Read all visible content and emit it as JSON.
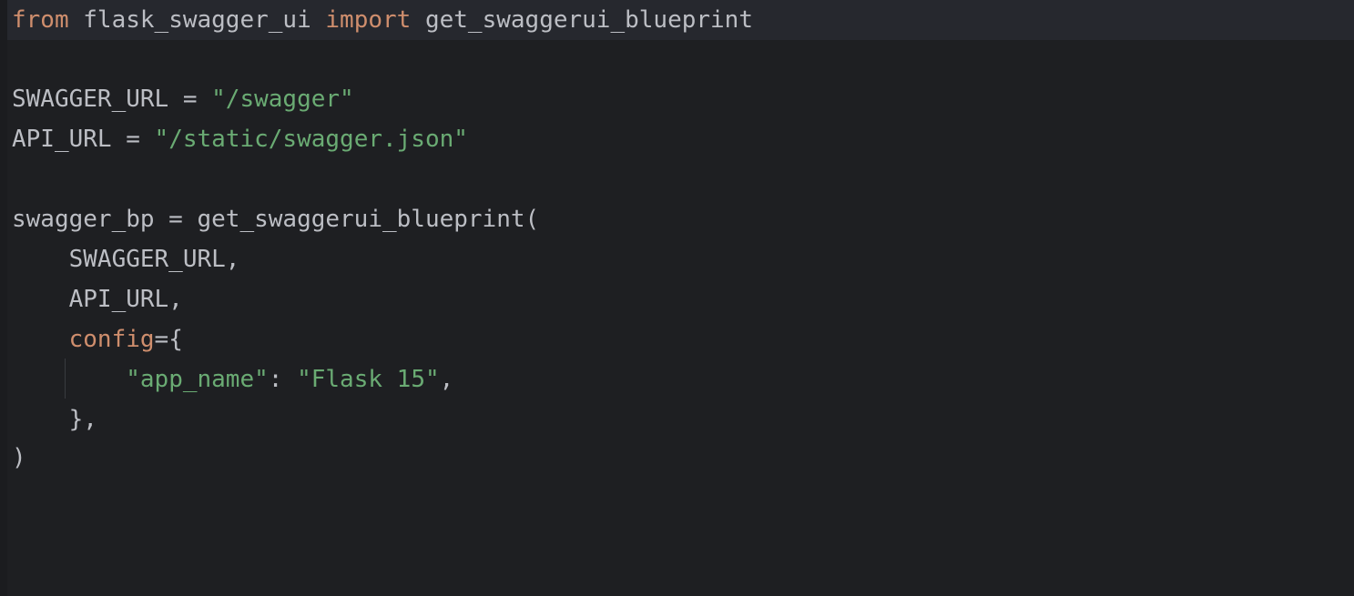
{
  "editor": {
    "colors": {
      "background": "#1e1f22",
      "current_line": "#26282e",
      "text": "#bcbec4",
      "keyword": "#cf8e6d",
      "string": "#6aab73",
      "named_param": "#cf8e6d"
    },
    "lines": [
      {
        "tokens": [
          {
            "t": "kw",
            "v": "from"
          },
          {
            "t": "plain",
            "v": " flask_swagger_ui "
          },
          {
            "t": "kw",
            "v": "import"
          },
          {
            "t": "plain",
            "v": " get_swaggerui_blueprint"
          }
        ]
      },
      {
        "tokens": []
      },
      {
        "tokens": [
          {
            "t": "plain",
            "v": "SWAGGER_URL = "
          },
          {
            "t": "str",
            "v": "\"/swagger\""
          }
        ]
      },
      {
        "tokens": [
          {
            "t": "plain",
            "v": "API_URL = "
          },
          {
            "t": "str",
            "v": "\"/static/swagger.json\""
          }
        ]
      },
      {
        "tokens": []
      },
      {
        "tokens": [
          {
            "t": "plain",
            "v": "swagger_bp = get_swaggerui_blueprint("
          }
        ]
      },
      {
        "tokens": [
          {
            "t": "plain",
            "v": "    SWAGGER_URL,"
          }
        ]
      },
      {
        "tokens": [
          {
            "t": "plain",
            "v": "    API_URL,"
          }
        ]
      },
      {
        "tokens": [
          {
            "t": "plain",
            "v": "    "
          },
          {
            "t": "param",
            "v": "config"
          },
          {
            "t": "plain",
            "v": "={"
          }
        ]
      },
      {
        "tokens": [
          {
            "t": "plain",
            "v": "        "
          },
          {
            "t": "str",
            "v": "\"app_name\""
          },
          {
            "t": "plain",
            "v": ": "
          },
          {
            "t": "str",
            "v": "\"Flask 15\""
          },
          {
            "t": "plain",
            "v": ","
          }
        ]
      },
      {
        "tokens": [
          {
            "t": "plain",
            "v": "    },"
          }
        ]
      },
      {
        "tokens": [
          {
            "t": "plain",
            "v": ")"
          }
        ]
      }
    ]
  }
}
